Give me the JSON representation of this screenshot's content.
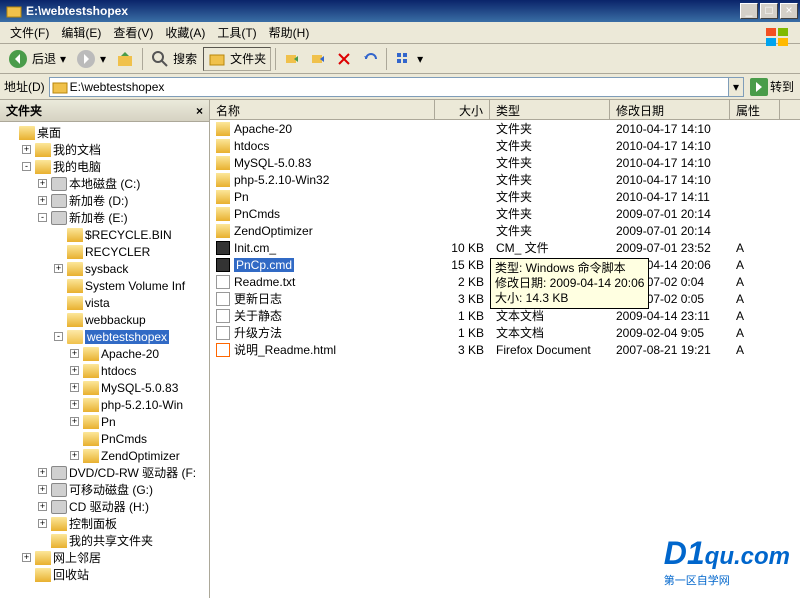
{
  "window": {
    "title": "E:\\webtestshopex"
  },
  "menu": [
    "文件(F)",
    "编辑(E)",
    "查看(V)",
    "收藏(A)",
    "工具(T)",
    "帮助(H)"
  ],
  "toolbar": {
    "back": "后退",
    "search": "搜索",
    "folders": "文件夹"
  },
  "address": {
    "label": "地址(D)",
    "path": "E:\\webtestshopex",
    "go": "转到"
  },
  "sidebar": {
    "title": "文件夹"
  },
  "tree": [
    {
      "l": 0,
      "e": "",
      "i": "desktop",
      "t": "桌面"
    },
    {
      "l": 1,
      "e": "+",
      "i": "folder",
      "t": "我的文档"
    },
    {
      "l": 1,
      "e": "-",
      "i": "computer",
      "t": "我的电脑"
    },
    {
      "l": 2,
      "e": "+",
      "i": "drive",
      "t": "本地磁盘 (C:)"
    },
    {
      "l": 2,
      "e": "+",
      "i": "drive",
      "t": "新加卷 (D:)"
    },
    {
      "l": 2,
      "e": "-",
      "i": "drive",
      "t": "新加卷 (E:)"
    },
    {
      "l": 3,
      "e": "",
      "i": "folder",
      "t": "$RECYCLE.BIN"
    },
    {
      "l": 3,
      "e": "",
      "i": "folder",
      "t": "RECYCLER"
    },
    {
      "l": 3,
      "e": "+",
      "i": "folder",
      "t": "sysback"
    },
    {
      "l": 3,
      "e": "",
      "i": "folder",
      "t": "System Volume Inf"
    },
    {
      "l": 3,
      "e": "",
      "i": "folder",
      "t": "vista"
    },
    {
      "l": 3,
      "e": "",
      "i": "folder",
      "t": "webbackup"
    },
    {
      "l": 3,
      "e": "-",
      "i": "folder-open",
      "t": "webtestshopex",
      "sel": true
    },
    {
      "l": 4,
      "e": "+",
      "i": "folder",
      "t": "Apache-20"
    },
    {
      "l": 4,
      "e": "+",
      "i": "folder",
      "t": "htdocs"
    },
    {
      "l": 4,
      "e": "+",
      "i": "folder",
      "t": "MySQL-5.0.83"
    },
    {
      "l": 4,
      "e": "+",
      "i": "folder",
      "t": "php-5.2.10-Win"
    },
    {
      "l": 4,
      "e": "+",
      "i": "folder",
      "t": "Pn"
    },
    {
      "l": 4,
      "e": "",
      "i": "folder",
      "t": "PnCmds"
    },
    {
      "l": 4,
      "e": "+",
      "i": "folder",
      "t": "ZendOptimizer"
    },
    {
      "l": 2,
      "e": "+",
      "i": "cd",
      "t": "DVD/CD-RW 驱动器 (F:"
    },
    {
      "l": 2,
      "e": "+",
      "i": "drive",
      "t": "可移动磁盘 (G:)"
    },
    {
      "l": 2,
      "e": "+",
      "i": "cd",
      "t": "CD 驱动器 (H:)"
    },
    {
      "l": 2,
      "e": "+",
      "i": "cpl",
      "t": "控制面板"
    },
    {
      "l": 2,
      "e": "",
      "i": "share",
      "t": "我的共享文件夹"
    },
    {
      "l": 1,
      "e": "+",
      "i": "net",
      "t": "网上邻居"
    },
    {
      "l": 1,
      "e": "",
      "i": "recycle",
      "t": "回收站"
    }
  ],
  "columns": {
    "name": "名称",
    "size": "大小",
    "type": "类型",
    "date": "修改日期",
    "attr": "属性"
  },
  "files": [
    {
      "i": "folder",
      "n": "Apache-20",
      "s": "",
      "t": "文件夹",
      "d": "2010-04-17 14:10",
      "a": ""
    },
    {
      "i": "folder",
      "n": "htdocs",
      "s": "",
      "t": "文件夹",
      "d": "2010-04-17 14:10",
      "a": ""
    },
    {
      "i": "folder",
      "n": "MySQL-5.0.83",
      "s": "",
      "t": "文件夹",
      "d": "2010-04-17 14:10",
      "a": ""
    },
    {
      "i": "folder",
      "n": "php-5.2.10-Win32",
      "s": "",
      "t": "文件夹",
      "d": "2010-04-17 14:10",
      "a": ""
    },
    {
      "i": "folder",
      "n": "Pn",
      "s": "",
      "t": "文件夹",
      "d": "2010-04-17 14:11",
      "a": ""
    },
    {
      "i": "folder",
      "n": "PnCmds",
      "s": "",
      "t": "文件夹",
      "d": "2009-07-01 20:14",
      "a": ""
    },
    {
      "i": "folder",
      "n": "ZendOptimizer",
      "s": "",
      "t": "文件夹",
      "d": "2009-07-01 20:14",
      "a": ""
    },
    {
      "i": "cmd",
      "n": "Init.cm_",
      "s": "10 KB",
      "t": "CM_ 文件",
      "d": "2009-07-01 23:52",
      "a": "A"
    },
    {
      "i": "cmd",
      "n": "PnCp.cmd",
      "s": "15 KB",
      "t": "Windows 命令脚本",
      "d": "2009-04-14 20:06",
      "a": "A",
      "sel": true
    },
    {
      "i": "txt",
      "n": "Readme.txt",
      "s": "2 KB",
      "t": "文本文档",
      "d": "2009-07-02 0:04",
      "a": "A"
    },
    {
      "i": "txt",
      "n": "更新日志",
      "s": "3 KB",
      "t": "文本文档",
      "d": "2009-07-02 0:05",
      "a": "A",
      "clip": true
    },
    {
      "i": "txt",
      "n": "关于静态",
      "s": "1 KB",
      "t": "文本文档",
      "d": "2009-04-14 23:11",
      "a": "A",
      "clip": true
    },
    {
      "i": "txt",
      "n": "升级方法",
      "s": "1 KB",
      "t": "文本文档",
      "d": "2009-02-04 9:05",
      "a": "A",
      "clip": true
    },
    {
      "i": "html",
      "n": "说明_Readme.html",
      "s": "3 KB",
      "t": "Firefox Document",
      "d": "2007-08-21 19:21",
      "a": "A"
    }
  ],
  "tooltip": {
    "l1": "类型: Windows 命令脚本",
    "l2": "修改日期: 2009-04-14 20:06",
    "l3": "大小: 14.3 KB"
  },
  "watermark": {
    "logo": "D1",
    "domain": "qu.com",
    "sub": "第一区自学网"
  }
}
